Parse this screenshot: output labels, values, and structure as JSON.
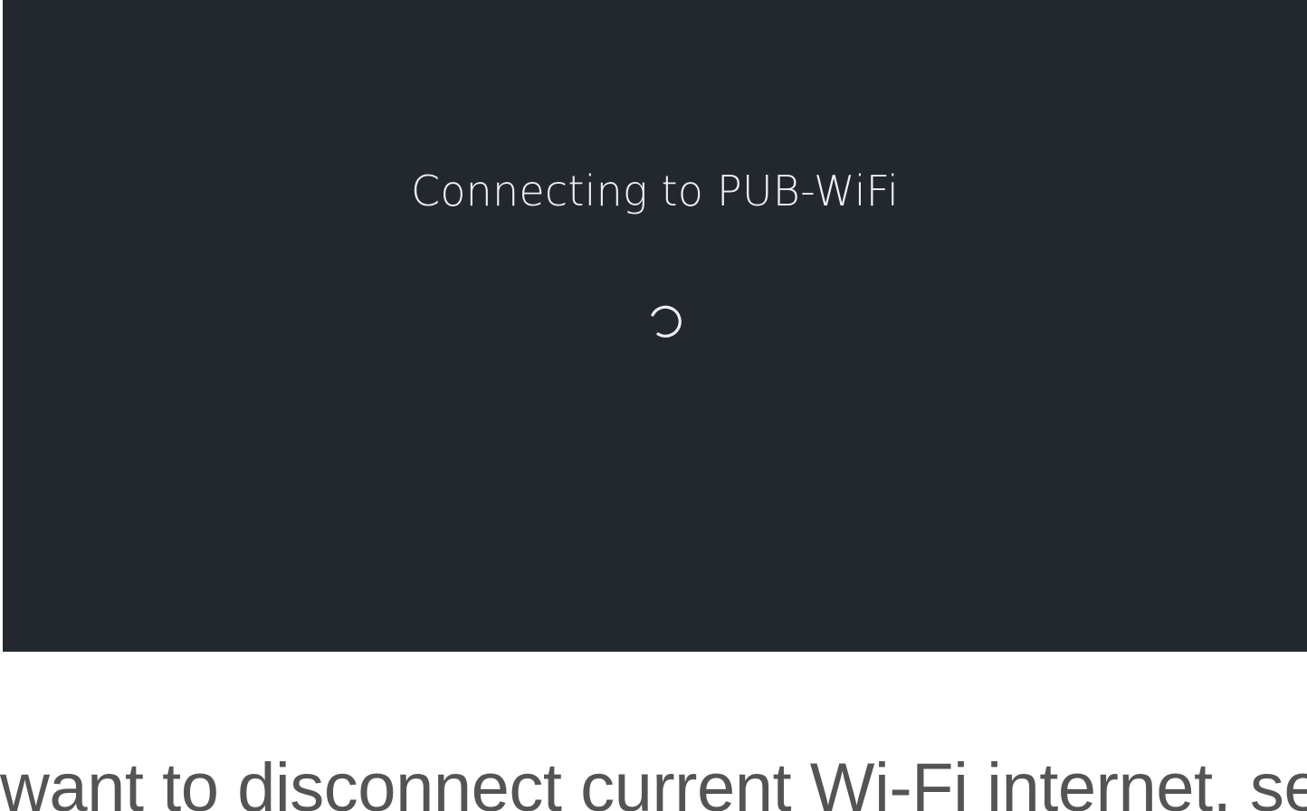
{
  "screen": {
    "status_text": "Connecting to PUB-WiFi",
    "spinner_icon": "loading-spinner-icon",
    "background_color": "#23282e",
    "text_color": "#eef0f2"
  },
  "caption": {
    "text": "want to disconnect current Wi-Fi internet, se"
  }
}
